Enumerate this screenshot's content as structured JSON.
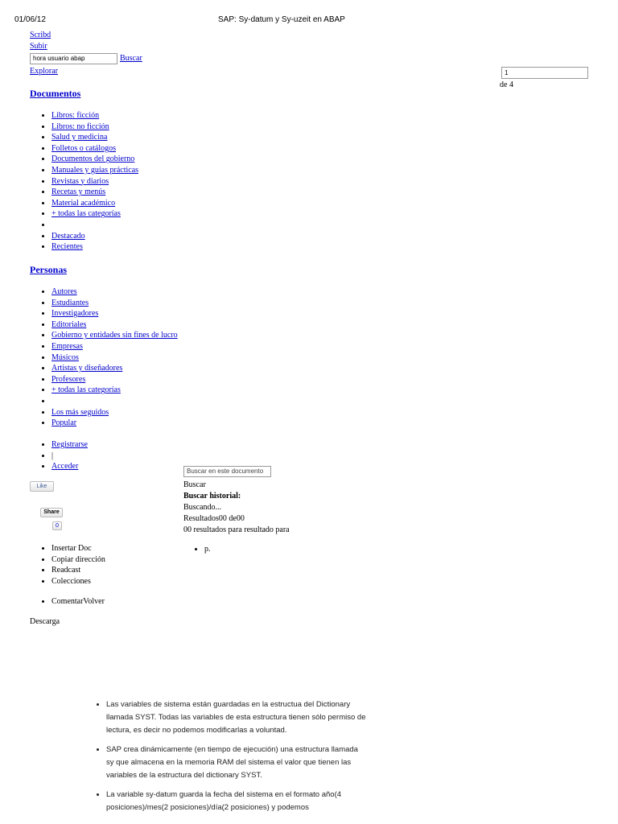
{
  "header": {
    "date": "01/06/12",
    "title": "SAP: Sy-datum y Sy-uzeit en ABAP"
  },
  "topnav": {
    "scribd": "Scribd",
    "subir": "Subir",
    "search_value": "hora usuario abap",
    "buscar": "Buscar",
    "explorar": "Explorar"
  },
  "pager": {
    "page_value": "1",
    "of_text": "de 4"
  },
  "documentos": {
    "title": "Documentos",
    "items": [
      "Libros: ficción",
      "Libros: no ficción",
      "Salud y medicina",
      "Folletos o catálogos",
      "Documentos del gobierno",
      "Manuales y guías prácticas",
      "Revistas y diarios",
      "Recetas y menús",
      "Material académico",
      "+ todas las categorías"
    ],
    "extra": [
      "Destacado",
      "Recientes"
    ]
  },
  "personas": {
    "title": "Personas",
    "items": [
      "Autores",
      "Estudiantes",
      "Investigadores",
      "Editoriales",
      "Gobierno y entidades sin fines de lucro",
      "Empresas",
      "Músicos",
      "Artistas y diseñadores",
      "Profesores",
      "+ todas las categorías"
    ],
    "extra": [
      "Los más seguidos",
      "Popular"
    ]
  },
  "account": {
    "register": "Registrarse",
    "separator": "|",
    "login": "Acceder"
  },
  "social": {
    "like": "Like",
    "share": "Share",
    "share_count": "0"
  },
  "doc_actions": [
    "Insertar Doc",
    "Copiar dirección",
    "Readcast",
    "Colecciones"
  ],
  "comment_back": "ComentarVolver",
  "download": "Descarga",
  "doc_search": {
    "placeholder": "Buscar en este documento",
    "buscar": "Buscar",
    "history": "Buscar historial:",
    "searching": "Buscando...",
    "results": "Resultados00 de00",
    "results_for": "00 resultados para resultado para",
    "p_item": "p."
  },
  "content": {
    "bullets": [
      "Las variables de sistema están guardadas en la estructua del Dictionary llamada SYST. Todas las variables de esta estructura tienen sólo permiso de lectura, es decir no podemos modificarlas a voluntad.",
      "SAP crea dinámicamente (en tiempo de ejecución) una estructura llamada sy que almacena en la memoria RAM del sistema el valor que tienen las variables de la estructura del dictionary SYST.",
      "La variable sy-datum guarda la fecha del sistema en el formato año(4 posiciones)/mes(2 posiciones)/día(2 posiciones) y podemos"
    ]
  }
}
